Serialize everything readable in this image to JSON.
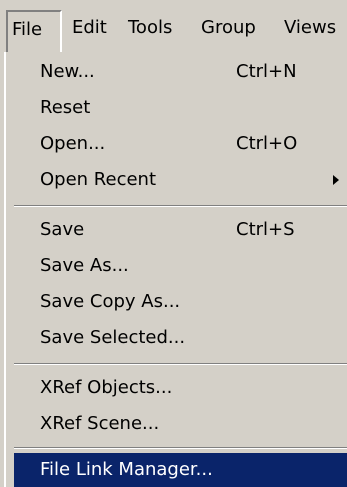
{
  "menubar": {
    "items": [
      {
        "label": "File"
      },
      {
        "label": "Edit"
      },
      {
        "label": "Tools"
      },
      {
        "label": "Group"
      },
      {
        "label": "Views"
      }
    ]
  },
  "file_menu": {
    "items": [
      {
        "label": "New...",
        "shortcut": "Ctrl+N"
      },
      {
        "label": "Reset",
        "shortcut": ""
      },
      {
        "label": "Open...",
        "shortcut": "Ctrl+O"
      },
      {
        "label": "Open Recent",
        "shortcut": "",
        "submenu": true
      },
      {
        "label": "Save",
        "shortcut": "Ctrl+S"
      },
      {
        "label": "Save As...",
        "shortcut": ""
      },
      {
        "label": "Save Copy As...",
        "shortcut": ""
      },
      {
        "label": "Save Selected...",
        "shortcut": ""
      },
      {
        "label": "XRef Objects...",
        "shortcut": ""
      },
      {
        "label": "XRef Scene...",
        "shortcut": ""
      },
      {
        "label": "File Link Manager...",
        "shortcut": "",
        "highlighted": true
      }
    ]
  },
  "colors": {
    "face": "#d4d0c8",
    "highlight": "#0a246a",
    "shadow": "#808080"
  },
  "icons": {
    "submenu": "submenu-arrow-icon"
  }
}
